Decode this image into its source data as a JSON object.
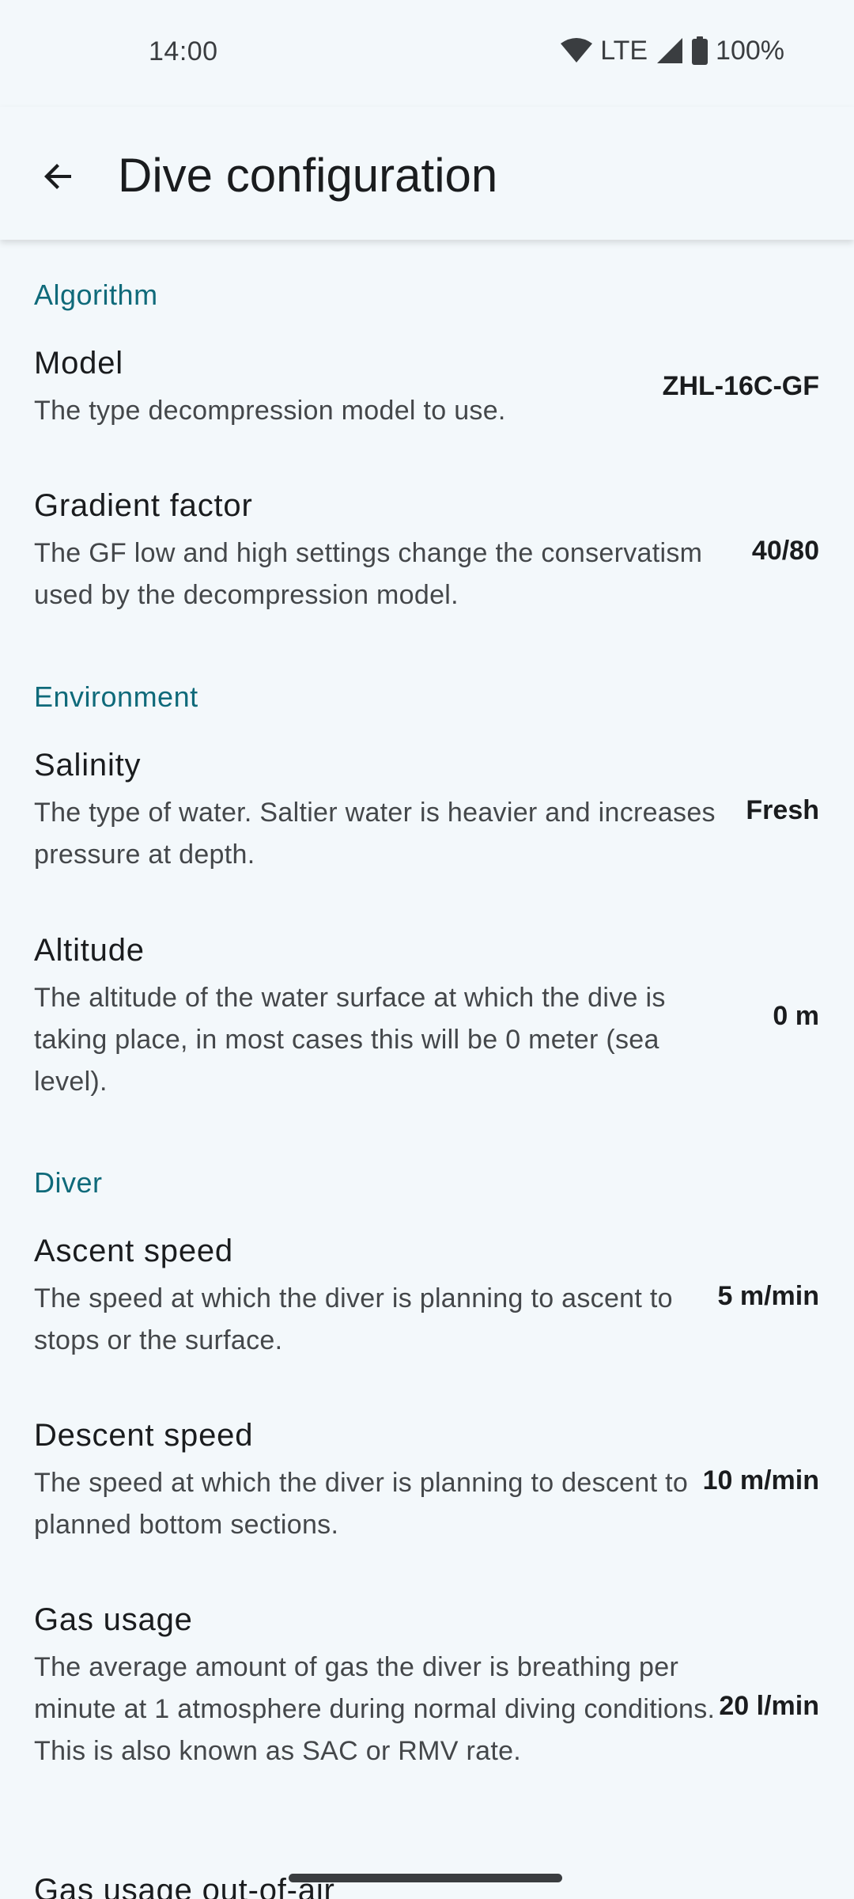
{
  "status_bar": {
    "time": "14:00",
    "network": "LTE",
    "battery": "100%",
    "icons": [
      "wifi-icon",
      "signal-icon",
      "battery-icon"
    ]
  },
  "app_bar": {
    "title": "Dive configuration",
    "back_icon": "arrow-back-icon"
  },
  "sections": {
    "algorithm": {
      "header": "Algorithm",
      "model": {
        "title": "Model",
        "summary": "The type decompression model to use.",
        "value": "ZHL-16C-GF"
      },
      "gradient_factor": {
        "title": "Gradient factor",
        "summary": "The GF low and high settings change the conservatism used by the decompression model.",
        "value": "40/80"
      }
    },
    "environment": {
      "header": "Environment",
      "salinity": {
        "title": "Salinity",
        "summary": "The type of water. Saltier water is heavier and increases pressure at depth.",
        "value": "Fresh"
      },
      "altitude": {
        "title": "Altitude",
        "summary": "The altitude of the water surface at which the dive is taking place, in most cases this will be 0 meter (sea level).",
        "value": "0 m"
      }
    },
    "diver": {
      "header": "Diver",
      "ascent_speed": {
        "title": "Ascent speed",
        "summary": "The speed at which the diver is planning to ascent to stops or the surface.",
        "value": "5 m/min"
      },
      "descent_speed": {
        "title": "Descent speed",
        "summary": "The speed at which the diver is planning to descent to planned bottom sections.",
        "value": "10 m/min"
      },
      "gas_usage": {
        "title": "Gas usage",
        "summary": "The average amount of gas the diver is breathing per minute at 1 atmosphere during normal diving conditions. This is also known as SAC or RMV rate.",
        "value": "20 l/min"
      },
      "gas_usage_out_of_air": {
        "title": "Gas usage out-of-air"
      }
    }
  },
  "colors": {
    "background": "#f3f8fb",
    "section_header": "#0f6a7a",
    "title_text": "#1a1c1e",
    "summary_text": "#44474a"
  }
}
